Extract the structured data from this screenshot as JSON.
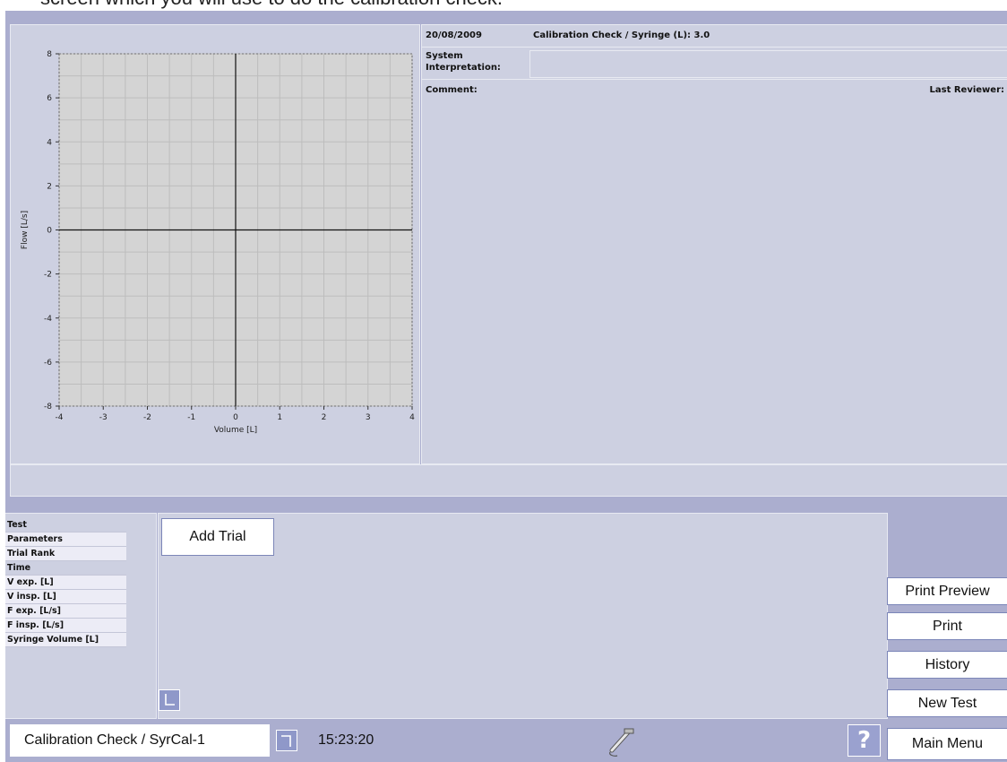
{
  "caption": "screen which you will use to do the calibration check.",
  "info": {
    "date": "20/08/2009",
    "test_title": "Calibration Check / Syringe (L): 3.0",
    "system_label": "System",
    "interpretation_label": "Interpretation:",
    "comment_label": "Comment:",
    "last_reviewer_label": "Last Reviewer:"
  },
  "params": {
    "rows": [
      "Test",
      "Parameters",
      "Trial Rank",
      "Time",
      "V exp. [L]",
      "V insp. [L]",
      "F exp. [L/s]",
      "F insp. [L/s]",
      "Syringe Volume [L]"
    ]
  },
  "trial": {
    "add_label": "Add Trial"
  },
  "buttons": {
    "print_preview": "Print Preview",
    "print": "Print",
    "history": "History",
    "new_test": "New Test",
    "main_menu": "Main Menu"
  },
  "footer": {
    "test_name": "Calibration Check / SyrCal-1",
    "time": "15:23:20",
    "help": "?"
  },
  "icons": {
    "corner": "corner-arrow-icon",
    "device": "spirometer-device-icon",
    "help": "help-icon"
  },
  "chart_data": {
    "type": "line",
    "xlabel": "Volume [L]",
    "ylabel": "Flow [L/s]",
    "xlim": [
      -4,
      4
    ],
    "ylim": [
      -8,
      8
    ],
    "xticks": [
      -4,
      -3,
      -2,
      -1,
      0,
      1,
      2,
      3,
      4
    ],
    "yticks": [
      8,
      6,
      4,
      2,
      0,
      -2,
      -4,
      -6,
      -8
    ],
    "grid": true,
    "series": []
  }
}
